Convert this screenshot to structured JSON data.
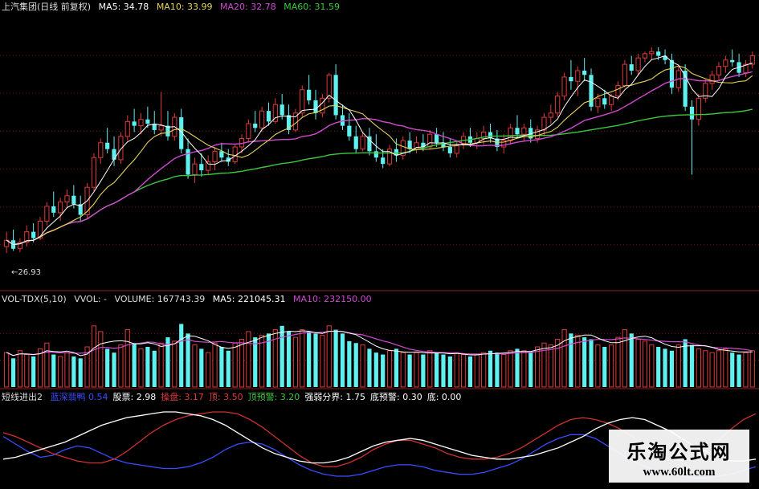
{
  "colors": {
    "up": "#e03a3a",
    "down": "#5ff0f0",
    "ma5": "#ffffff",
    "ma10": "#e6d45a",
    "ma20": "#d04ad0",
    "ma60": "#3cc83c",
    "vol_ma5": "#ffffff",
    "vol_ma10": "#d04ad0",
    "osc_white": "#ffffff",
    "osc_red": "#d03030",
    "osc_blue": "#3a4cff",
    "grid": "#6a1e1e"
  },
  "price_header": {
    "title": "上汽集团(日线 前复权)",
    "ma5": "MA5: 34.78",
    "ma10": "MA10: 33.99",
    "ma20": "MA20: 32.78",
    "ma60": "MA60: 31.59"
  },
  "volume_header": {
    "title": "VOL-TDX(5,10)",
    "vvol": "VVOL: -",
    "volume": "VOLUME: 167743.39",
    "ma5": "MA5: 221045.31",
    "ma10": "MA10: 232150.00"
  },
  "osc_header": {
    "title": "短线进出2",
    "items": [
      {
        "text": "蓝深翡鸭 0.54",
        "color": "#3a4cff"
      },
      {
        "text": "股票: 2.98",
        "color": "#ffffff"
      },
      {
        "text": "操盘: 3.17",
        "color": "#e03a3a"
      },
      {
        "text": "顶: 3.50",
        "color": "#e03a3a"
      },
      {
        "text": "顶预警: 3.20",
        "color": "#3cc83c"
      },
      {
        "text": "强弱分界: 1.75",
        "color": "#ffffff"
      },
      {
        "text": "底预警: 0.30",
        "color": "#ffffff"
      },
      {
        "text": "底: 0.00",
        "color": "#ffffff"
      }
    ]
  },
  "low_label": "←26.93",
  "watermark": {
    "cn": "乐淘公式网",
    "url": "www.60lt.com"
  },
  "chart_data": {
    "type": "candlestick",
    "price_range": [
      25.5,
      38.0
    ],
    "volume_range": [
      0,
      420000
    ],
    "osc_range": [
      0,
      4
    ],
    "candles": [
      [
        27.2,
        27.9,
        26.9,
        27.5
      ],
      [
        27.5,
        28.0,
        27.0,
        27.1
      ],
      [
        27.1,
        27.6,
        26.93,
        27.4
      ],
      [
        27.4,
        28.2,
        27.2,
        27.9
      ],
      [
        27.9,
        28.3,
        27.4,
        27.6
      ],
      [
        27.6,
        28.6,
        27.5,
        28.4
      ],
      [
        28.4,
        29.3,
        28.2,
        29.1
      ],
      [
        29.1,
        29.8,
        28.6,
        28.8
      ],
      [
        28.8,
        29.5,
        28.4,
        29.3
      ],
      [
        29.3,
        29.9,
        29.0,
        29.6
      ],
      [
        29.6,
        30.1,
        29.0,
        29.2
      ],
      [
        29.2,
        29.6,
        28.4,
        28.7
      ],
      [
        28.7,
        30.2,
        28.5,
        30.0
      ],
      [
        30.0,
        31.6,
        29.8,
        31.4
      ],
      [
        31.4,
        32.3,
        31.1,
        32.1
      ],
      [
        32.1,
        32.8,
        31.6,
        31.8
      ],
      [
        31.8,
        32.4,
        31.0,
        31.3
      ],
      [
        31.3,
        32.6,
        31.1,
        32.4
      ],
      [
        32.4,
        33.4,
        32.2,
        33.1
      ],
      [
        33.1,
        33.7,
        32.6,
        32.9
      ],
      [
        32.9,
        33.5,
        32.5,
        33.2
      ],
      [
        33.2,
        33.8,
        32.8,
        33.0
      ],
      [
        33.0,
        33.6,
        32.5,
        32.7
      ],
      [
        32.7,
        34.5,
        32.4,
        32.9
      ],
      [
        32.9,
        33.6,
        32.2,
        32.4
      ],
      [
        32.4,
        33.5,
        32.2,
        33.3
      ],
      [
        33.3,
        33.7,
        31.6,
        31.8
      ],
      [
        31.8,
        32.3,
        30.4,
        30.6
      ],
      [
        30.6,
        31.4,
        30.2,
        31.1
      ],
      [
        31.1,
        31.6,
        30.5,
        30.8
      ],
      [
        30.8,
        31.5,
        30.6,
        31.2
      ],
      [
        31.2,
        31.9,
        30.8,
        31.7
      ],
      [
        31.7,
        32.1,
        31.2,
        31.4
      ],
      [
        31.4,
        31.8,
        31.0,
        31.2
      ],
      [
        31.2,
        32.0,
        31.1,
        31.9
      ],
      [
        31.9,
        32.5,
        31.6,
        32.3
      ],
      [
        32.3,
        33.2,
        32.1,
        33.0
      ],
      [
        33.0,
        33.6,
        32.6,
        32.8
      ],
      [
        32.8,
        33.8,
        32.6,
        33.6
      ],
      [
        33.6,
        34.0,
        32.9,
        33.1
      ],
      [
        33.1,
        34.2,
        33.0,
        33.9
      ],
      [
        33.9,
        34.4,
        33.2,
        33.4
      ],
      [
        33.4,
        33.9,
        32.5,
        32.7
      ],
      [
        32.7,
        33.7,
        32.6,
        33.5
      ],
      [
        33.5,
        34.8,
        33.3,
        34.6
      ],
      [
        34.6,
        35.3,
        33.9,
        34.1
      ],
      [
        34.1,
        34.6,
        33.2,
        33.5
      ],
      [
        33.5,
        34.4,
        33.3,
        34.2
      ],
      [
        34.2,
        35.4,
        34.0,
        35.3
      ],
      [
        35.3,
        35.8,
        33.2,
        33.4
      ],
      [
        33.4,
        33.9,
        32.7,
        32.9
      ],
      [
        32.9,
        33.5,
        32.2,
        32.4
      ],
      [
        32.4,
        32.9,
        31.6,
        31.8
      ],
      [
        31.8,
        32.6,
        31.7,
        32.4
      ],
      [
        32.4,
        32.8,
        31.5,
        31.7
      ],
      [
        31.7,
        32.5,
        31.2,
        31.4
      ],
      [
        31.4,
        31.8,
        30.9,
        31.1
      ],
      [
        31.1,
        32.0,
        31.0,
        31.8
      ],
      [
        31.8,
        32.3,
        31.2,
        31.5
      ],
      [
        31.5,
        32.4,
        31.3,
        32.2
      ],
      [
        32.2,
        32.6,
        31.6,
        31.8
      ],
      [
        31.8,
        32.4,
        31.6,
        32.1
      ],
      [
        32.1,
        32.5,
        31.7,
        31.9
      ],
      [
        31.9,
        32.7,
        31.8,
        32.5
      ],
      [
        32.5,
        32.8,
        31.9,
        32.1
      ],
      [
        32.1,
        32.6,
        31.7,
        31.9
      ],
      [
        31.9,
        32.3,
        31.4,
        31.6
      ],
      [
        31.6,
        32.2,
        31.4,
        32.0
      ],
      [
        32.0,
        32.6,
        31.8,
        32.4
      ],
      [
        32.4,
        32.8,
        31.9,
        32.1
      ],
      [
        32.1,
        32.6,
        31.8,
        32.3
      ],
      [
        32.3,
        32.9,
        32.0,
        32.6
      ],
      [
        32.6,
        33.0,
        32.1,
        32.3
      ],
      [
        32.3,
        32.7,
        31.7,
        31.9
      ],
      [
        31.9,
        32.5,
        31.6,
        32.2
      ],
      [
        32.2,
        33.0,
        32.0,
        32.8
      ],
      [
        32.8,
        33.4,
        32.3,
        32.5
      ],
      [
        32.5,
        33.0,
        32.2,
        32.8
      ],
      [
        32.8,
        33.2,
        32.1,
        32.3
      ],
      [
        32.3,
        32.9,
        32.1,
        32.7
      ],
      [
        32.7,
        33.5,
        32.4,
        33.3
      ],
      [
        33.3,
        33.9,
        33.0,
        33.5
      ],
      [
        33.5,
        34.5,
        33.3,
        34.3
      ],
      [
        34.3,
        35.4,
        34.1,
        35.2
      ],
      [
        35.2,
        36.0,
        34.6,
        35.0
      ],
      [
        35.0,
        35.7,
        34.3,
        35.5
      ],
      [
        35.5,
        36.1,
        35.0,
        35.3
      ],
      [
        35.3,
        35.6,
        33.6,
        33.8
      ],
      [
        33.8,
        34.4,
        33.5,
        34.2
      ],
      [
        34.2,
        34.6,
        33.7,
        33.9
      ],
      [
        33.9,
        34.4,
        33.6,
        34.3
      ],
      [
        34.3,
        35.0,
        34.1,
        34.8
      ],
      [
        34.8,
        36.0,
        34.7,
        35.8
      ],
      [
        35.8,
        36.2,
        35.3,
        35.5
      ],
      [
        35.5,
        36.3,
        35.3,
        36.1
      ],
      [
        36.1,
        36.4,
        35.9,
        36.3
      ],
      [
        36.3,
        36.6,
        36.0,
        36.4
      ],
      [
        36.4,
        36.6,
        36.0,
        36.2
      ],
      [
        36.2,
        36.5,
        35.8,
        36.0
      ],
      [
        36.0,
        36.3,
        34.4,
        34.7
      ],
      [
        34.7,
        35.7,
        34.5,
        35.5
      ],
      [
        35.5,
        35.8,
        33.6,
        33.8
      ],
      [
        33.8,
        34.1,
        30.6,
        33.2
      ],
      [
        33.2,
        34.4,
        32.9,
        34.2
      ],
      [
        34.2,
        35.1,
        34.0,
        34.9
      ],
      [
        34.9,
        35.5,
        34.6,
        35.3
      ],
      [
        35.3,
        35.9,
        35.0,
        35.7
      ],
      [
        35.7,
        36.2,
        35.4,
        36.0
      ],
      [
        36.0,
        36.5,
        35.7,
        35.9
      ],
      [
        35.9,
        36.3,
        35.2,
        35.4
      ],
      [
        35.4,
        36.0,
        35.2,
        35.8
      ],
      [
        35.8,
        36.4,
        35.6,
        36.2
      ]
    ],
    "volumes": [
      180000,
      150000,
      190000,
      170000,
      160000,
      200000,
      230000,
      170000,
      160000,
      180000,
      160000,
      150000,
      210000,
      320000,
      290000,
      200000,
      180000,
      220000,
      300000,
      230000,
      200000,
      210000,
      190000,
      230000,
      260000,
      240000,
      330000,
      280000,
      220000,
      200000,
      180000,
      230000,
      210000,
      190000,
      230000,
      250000,
      290000,
      260000,
      270000,
      280000,
      300000,
      320000,
      290000,
      260000,
      300000,
      290000,
      280000,
      270000,
      320000,
      300000,
      280000,
      240000,
      230000,
      220000,
      200000,
      180000,
      170000,
      190000,
      200000,
      180000,
      170000,
      180000,
      170000,
      190000,
      180000,
      170000,
      160000,
      180000,
      170000,
      160000,
      170000,
      180000,
      190000,
      180000,
      170000,
      190000,
      200000,
      190000,
      180000,
      210000,
      230000,
      220000,
      250000,
      300000,
      280000,
      270000,
      260000,
      250000,
      220000,
      210000,
      220000,
      260000,
      300000,
      280000,
      250000,
      240000,
      220000,
      210000,
      200000,
      190000,
      220000,
      250000,
      220000,
      200000,
      190000,
      180000,
      190000,
      200000,
      180000,
      170000,
      180000,
      190000
    ],
    "osc_lines": {
      "white": [
        1.2,
        1.3,
        1.5,
        1.7,
        1.9,
        2.1,
        2.4,
        2.7,
        3.0,
        3.2,
        3.4,
        3.5,
        3.6,
        3.7,
        3.7,
        3.6,
        3.5,
        3.3,
        3.0,
        2.6,
        2.2,
        1.8,
        1.5,
        1.3,
        1.1,
        1.0,
        1.0,
        1.1,
        1.3,
        1.6,
        1.9,
        2.1,
        2.2,
        2.3,
        2.2,
        2.0,
        1.8,
        1.6,
        1.4,
        1.3,
        1.2,
        1.2,
        1.3,
        1.4,
        1.6,
        1.8,
        2.1,
        2.4,
        2.8,
        3.1,
        3.3,
        3.4,
        3.3,
        3.0,
        2.7,
        2.3,
        1.9,
        1.6,
        1.3,
        1.1,
        1.1,
        1.2
      ],
      "red": [
        2.6,
        2.4,
        2.1,
        1.8,
        1.5,
        1.3,
        1.1,
        1.0,
        1.0,
        1.2,
        1.6,
        2.1,
        2.6,
        3.0,
        3.3,
        3.5,
        3.6,
        3.7,
        3.7,
        3.6,
        3.3,
        2.9,
        2.4,
        1.9,
        1.4,
        1.0,
        0.8,
        0.8,
        1.0,
        1.3,
        1.7,
        2.0,
        2.2,
        2.2,
        2.0,
        1.8,
        1.5,
        1.3,
        1.2,
        1.2,
        1.3,
        1.5,
        1.8,
        2.2,
        2.6,
        3.0,
        3.3,
        3.4,
        3.3,
        3.1,
        2.8,
        2.4,
        1.9,
        1.5,
        1.2,
        1.1,
        1.3,
        1.7,
        2.2,
        2.8,
        3.3,
        3.6
      ],
      "blue": [
        2.4,
        2.0,
        1.6,
        1.3,
        1.4,
        1.7,
        1.9,
        1.8,
        1.5,
        1.2,
        1.0,
        0.9,
        0.8,
        0.7,
        0.7,
        0.8,
        1.0,
        1.3,
        1.7,
        2.0,
        2.1,
        2.0,
        1.7,
        1.3,
        0.9,
        0.6,
        0.4,
        0.3,
        0.3,
        0.4,
        0.6,
        0.8,
        0.9,
        0.9,
        0.8,
        0.6,
        0.5,
        0.4,
        0.4,
        0.5,
        0.7,
        0.9,
        1.2,
        1.6,
        2.0,
        2.3,
        2.5,
        2.5,
        2.3,
        1.9,
        1.5,
        1.1,
        0.8,
        0.6,
        0.4,
        0.3,
        0.2,
        0.2,
        0.3,
        0.4,
        0.6,
        0.8
      ]
    }
  }
}
